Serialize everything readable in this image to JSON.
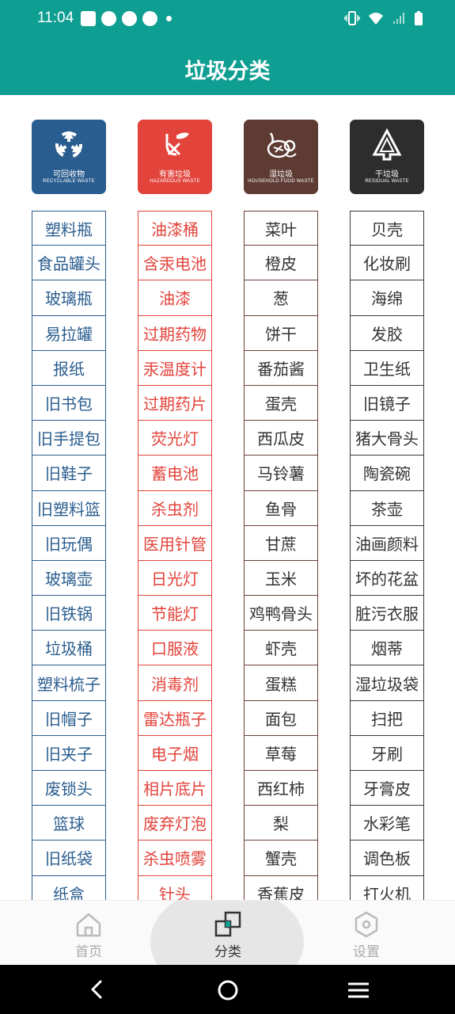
{
  "status_bar": {
    "time": "11:04",
    "left_icons": [
      "gmail-icon",
      "sync-icon",
      "sync-icon",
      "sync-icon",
      "dot-icon"
    ],
    "right_icons": [
      "vibrate-icon",
      "wifi-icon",
      "signal-icon",
      "battery-icon"
    ]
  },
  "header": {
    "title": "垃圾分类"
  },
  "categories": [
    {
      "key": "recycle",
      "name_cn": "可回收物",
      "name_en": "RECYCLABLE WASTE",
      "icon": "recycle-icon",
      "badge_color": "#2a5d8f",
      "text_color": "#2a5d8f",
      "items": [
        "塑料瓶",
        "食品罐头",
        "玻璃瓶",
        "易拉罐",
        "报纸",
        "旧书包",
        "旧手提包",
        "旧鞋子",
        "旧塑料篮",
        "旧玩偶",
        "玻璃壶",
        "旧铁锅",
        "垃圾桶",
        "塑料梳子",
        "旧帽子",
        "旧夹子",
        "废锁头",
        "篮球",
        "旧纸袋",
        "纸盒"
      ]
    },
    {
      "key": "hazard",
      "name_cn": "有害垃圾",
      "name_en": "HAZARDOUS WASTE",
      "icon": "hazard-icon",
      "badge_color": "#e2433b",
      "text_color": "#e2433b",
      "items": [
        "油漆桶",
        "含汞电池",
        "油漆",
        "过期药物",
        "汞温度计",
        "过期药片",
        "荧光灯",
        "蓄电池",
        "杀虫剂",
        "医用针管",
        "日光灯",
        "节能灯",
        "口服液",
        "消毒剂",
        "雷达瓶子",
        "电子烟",
        "相片底片",
        "废弃灯泡",
        "杀虫喷雾",
        "针头"
      ]
    },
    {
      "key": "wet",
      "name_cn": "湿垃圾",
      "name_en": "HOUSEHOLD FOOD WASTE",
      "icon": "food-waste-icon",
      "badge_color": "#5d3b32",
      "text_color": "#333333",
      "items": [
        "菜叶",
        "橙皮",
        "葱",
        "饼干",
        "番茄酱",
        "蛋壳",
        "西瓜皮",
        "马铃薯",
        "鱼骨",
        "甘蔗",
        "玉米",
        "鸡鸭骨头",
        "虾壳",
        "蛋糕",
        "面包",
        "草莓",
        "西红柿",
        "梨",
        "蟹壳",
        "香蕉皮"
      ]
    },
    {
      "key": "dry",
      "name_cn": "干垃圾",
      "name_en": "RESIDUAL WASTE",
      "icon": "residual-waste-icon",
      "badge_color": "#2d2d2d",
      "text_color": "#333333",
      "items": [
        "贝壳",
        "化妆刷",
        "海绵",
        "发胶",
        "卫生纸",
        "旧镜子",
        "猪大骨头",
        "陶瓷碗",
        "茶壶",
        "油画颜料",
        "坏的花盆",
        "脏污衣服",
        "烟蒂",
        "湿垃圾袋",
        "扫把",
        "牙刷",
        "牙膏皮",
        "水彩笔",
        "调色板",
        "打火机"
      ]
    }
  ],
  "bottom_nav": {
    "items": [
      {
        "label": "首页",
        "icon": "home-icon",
        "active": false
      },
      {
        "label": "分类",
        "icon": "category-icon",
        "active": true
      },
      {
        "label": "设置",
        "icon": "settings-icon",
        "active": false
      }
    ],
    "accent": "#0f9e92"
  },
  "system_nav": {
    "icons": [
      "back-icon",
      "home-circle-icon",
      "menu-icon"
    ]
  }
}
